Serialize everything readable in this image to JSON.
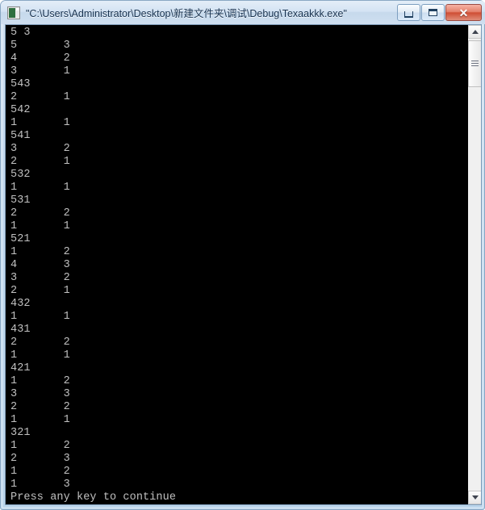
{
  "window": {
    "title": "\"C:\\Users\\Administrator\\Desktop\\新建文件夹\\调试\\Debug\\Texaakkk.exe\"",
    "icon_name": "console-app-icon",
    "frame_color": "#c3d9ee",
    "title_color": "#16314f"
  },
  "caption_buttons": {
    "minimize_label": "",
    "maximize_label": "",
    "close_label": "✕",
    "close_color": "#cf4e34"
  },
  "console": {
    "background": "#000000",
    "foreground": "#c0c0c0",
    "lines": [
      "5 3",
      "5       3",
      "4       2",
      "3       1",
      "543",
      "2       1",
      "542",
      "1       1",
      "541",
      "3       2",
      "2       1",
      "532",
      "1       1",
      "531",
      "2       2",
      "1       1",
      "521",
      "1       2",
      "4       3",
      "3       2",
      "2       1",
      "432",
      "1       1",
      "431",
      "2       2",
      "1       1",
      "421",
      "1       2",
      "3       3",
      "2       2",
      "1       1",
      "321",
      "1       2",
      "2       3",
      "1       2",
      "1       3",
      "Press any key to continue"
    ],
    "prompt_text": "Press any key to continue"
  },
  "scrollbar": {
    "up_arrow_icon": "triangle-up-icon",
    "down_arrow_icon": "triangle-down-icon",
    "thumb_grip_icon": "grip-lines-icon"
  }
}
